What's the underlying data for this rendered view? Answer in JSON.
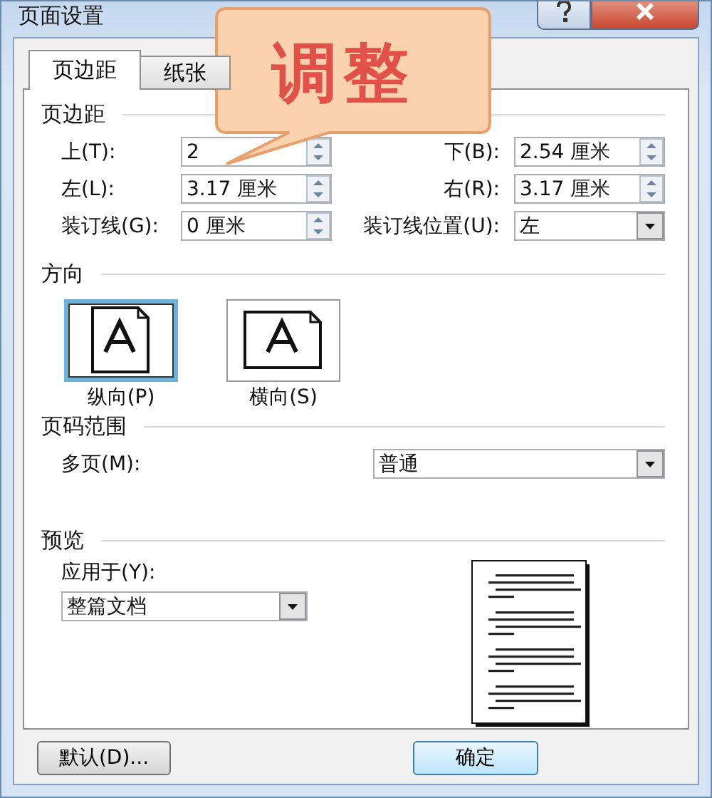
{
  "window": {
    "title": "页面设置"
  },
  "tabs": [
    {
      "label": "页边距",
      "selected": true
    },
    {
      "label": "纸张",
      "selected": false
    }
  ],
  "callout": {
    "text": "调整"
  },
  "margins": {
    "title": "页边距",
    "fields": [
      {
        "label": "上(T):",
        "value": "2",
        "kind": "spin"
      },
      {
        "label": "下(B):",
        "value": "2.54 厘米",
        "kind": "spin"
      },
      {
        "label": "左(L):",
        "value": "3.17 厘米",
        "kind": "spin"
      },
      {
        "label": "右(R):",
        "value": "3.17 厘米",
        "kind": "spin"
      },
      {
        "label": "装订线(G):",
        "value": "0 厘米",
        "kind": "spin"
      },
      {
        "label": "装订线位置(U):",
        "value": "左",
        "kind": "dropdown"
      }
    ]
  },
  "orientation": {
    "title": "方向",
    "options": [
      {
        "label": "纵向(P)",
        "kind": "portrait",
        "selected": true
      },
      {
        "label": "横向(S)",
        "kind": "landscape",
        "selected": false
      }
    ]
  },
  "page_range": {
    "title": "页码范围",
    "label": "多页(M):",
    "value": "普通"
  },
  "preview": {
    "title": "预览",
    "apply_label": "应用于(Y):",
    "apply_value": "整篇文档"
  },
  "buttons": [
    {
      "label": "默认(D)...",
      "kind": "default"
    },
    {
      "label": "确定",
      "kind": "ok"
    }
  ]
}
